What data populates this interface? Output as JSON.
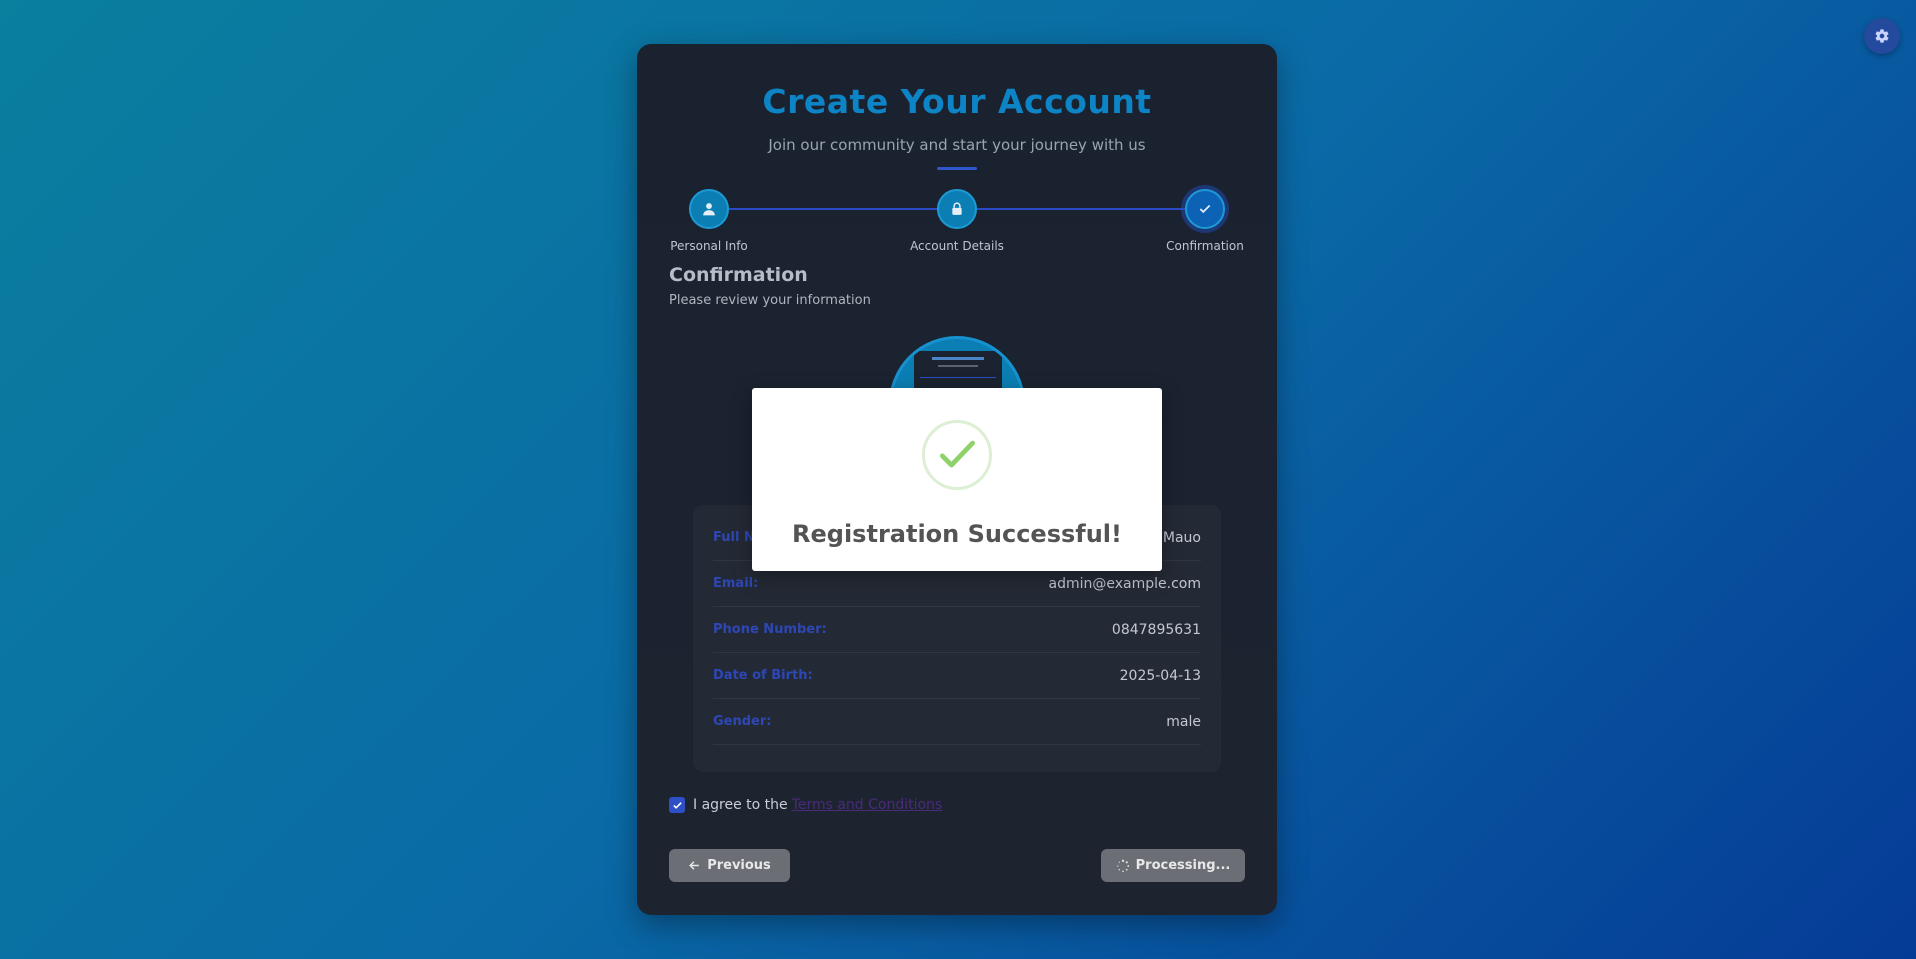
{
  "header": {
    "title": "Create Your Account",
    "subtitle": "Join our community and start your journey with us"
  },
  "steps": [
    {
      "label": "Personal Info",
      "icon": "user-icon"
    },
    {
      "label": "Account Details",
      "icon": "lock-icon"
    },
    {
      "label": "Confirmation",
      "icon": "check-icon"
    }
  ],
  "section": {
    "title": "Confirmation",
    "subtitle": "Please review your information"
  },
  "summary": [
    {
      "key": "Full Name:",
      "value": "Mauo"
    },
    {
      "key": "Email:",
      "value": "admin@example.com"
    },
    {
      "key": "Phone Number:",
      "value": "0847895631"
    },
    {
      "key": "Date of Birth:",
      "value": "2025-04-13"
    },
    {
      "key": "Gender:",
      "value": "male"
    }
  ],
  "terms": {
    "text": "I agree to the",
    "link": "Terms and Conditions",
    "checked": true
  },
  "buttons": {
    "previous": "Previous",
    "processing": "Processing..."
  },
  "modal": {
    "message": "Registration Successful!"
  },
  "colors": {
    "accent": "#0d84c6",
    "primary": "#2e4fc6",
    "success": "#8fd16b"
  }
}
